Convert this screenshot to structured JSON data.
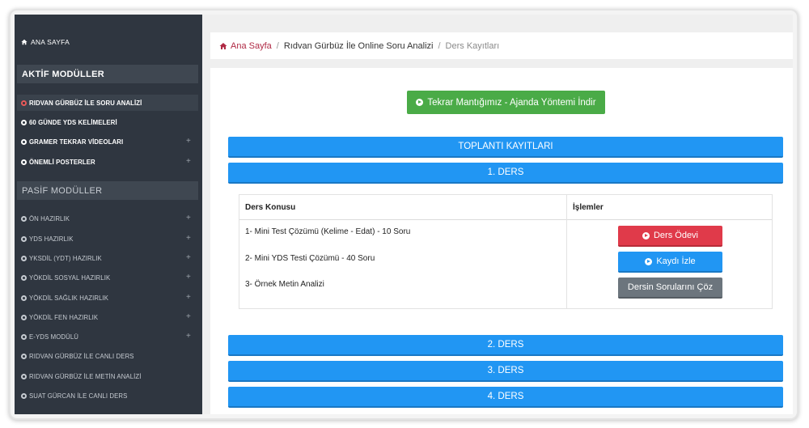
{
  "sidebar": {
    "home_label": "ANA SAYFA",
    "active_section_title": "AKTİF MODÜLLER",
    "active_items": [
      {
        "label": "RIDVAN GÜRBÜZ İLE SORU ANALİZİ",
        "has_plus": false,
        "selected": true
      },
      {
        "label": "60 GÜNDE YDS KELİMELERİ",
        "has_plus": false
      },
      {
        "label": "GRAMER TEKRAR VİDEOLARI",
        "has_plus": true
      },
      {
        "label": "ÖNEMLİ POSTERLER",
        "has_plus": true
      }
    ],
    "passive_section_title": "PASİF MODÜLLER",
    "passive_items": [
      {
        "label": "ÖN HAZIRLIK",
        "has_plus": true
      },
      {
        "label": "YDS HAZIRLIK",
        "has_plus": true
      },
      {
        "label": "YKSDİL (YDT) HAZIRLIK",
        "has_plus": true
      },
      {
        "label": "YÖKDİL SOSYAL HAZIRLIK",
        "has_plus": true
      },
      {
        "label": "YÖKDİL SAĞLIK HAZIRLIK",
        "has_plus": true
      },
      {
        "label": "YÖKDİL FEN HAZIRLIK",
        "has_plus": true
      },
      {
        "label": "E-YDS MODÜLÜ",
        "has_plus": true
      },
      {
        "label": "RIDVAN GÜRBÜZ İLE CANLI DERS",
        "has_plus": false
      },
      {
        "label": "RIDVAN GÜRBÜZ İLE METİN ANALİZİ",
        "has_plus": false
      },
      {
        "label": "SUAT GÜRCAN İLE CANLI DERS",
        "has_plus": false
      }
    ],
    "plus_symbol": "+"
  },
  "breadcrumb": {
    "home": "Ana Sayfa",
    "separator": "/",
    "middle": "Rıdvan Gürbüz İle Online Soru Analizi",
    "current": "Ders Kayıtları"
  },
  "download_button": "Tekrar Mantığımız - Ajanda Yöntemi İndir",
  "meetings_header": "TOPLANTI KAYITLARI",
  "lessons": [
    "1. DERS",
    "2. DERS",
    "3. DERS",
    "4. DERS"
  ],
  "lesson_table": {
    "col_topic": "Ders Konusu",
    "col_actions": "İşlemler",
    "topics": [
      "1- Mini Test Çözümü (Kelime - Edat) - 10 Soru",
      "2- Mini YDS Testi Çözümü - 40 Soru",
      "3- Örnek Metin Analizi"
    ],
    "buttons": {
      "homework": "Ders Ödevi",
      "watch": "Kaydı İzle",
      "solve": "Dersin Sorularını Çöz"
    }
  },
  "colors": {
    "sidebar_bg": "#2f3640",
    "primary_blue": "#2196f3",
    "success_green": "#4aab47",
    "danger_red": "#e03a4a",
    "secondary_gray": "#6c757d",
    "brand_red": "#b02a45"
  },
  "icons": {
    "home": "home-icon",
    "item": "circle-arrow-icon",
    "download": "circle-arrow-right-icon"
  }
}
